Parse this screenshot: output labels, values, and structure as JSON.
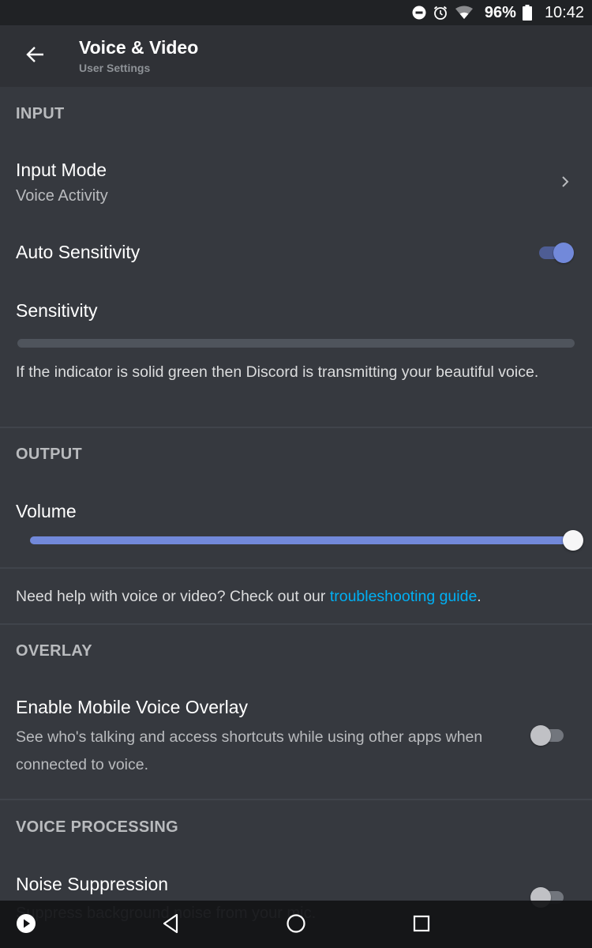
{
  "status_bar": {
    "icons": [
      "do-not-disturb-icon",
      "alarm-icon",
      "wifi-icon",
      "battery-icon"
    ],
    "battery_percent": "96%",
    "time": "10:42"
  },
  "header": {
    "back_icon": "arrow-left-icon",
    "title": "Voice & Video",
    "subtitle": "User Settings"
  },
  "sections": {
    "input": {
      "header": "INPUT",
      "input_mode": {
        "title": "Input Mode",
        "value": "Voice Activity"
      },
      "auto_sensitivity": {
        "title": "Auto Sensitivity",
        "enabled": true
      },
      "sensitivity": {
        "title": "Sensitivity"
      },
      "description": "If the indicator is solid green then Discord is transmitting your beautiful voice."
    },
    "output": {
      "header": "OUTPUT",
      "volume": {
        "title": "Volume",
        "value_percent": 100
      }
    },
    "help": {
      "text": "Need help with voice or video? Check out our ",
      "link": "troubleshooting guide",
      "suffix": "."
    },
    "overlay": {
      "header": "OVERLAY",
      "mobile_voice_overlay": {
        "title": "Enable Mobile Voice Overlay",
        "description": "See who's talking and access shortcuts while using other apps when connected to voice.",
        "enabled": false
      }
    },
    "voice_processing": {
      "header": "VOICE PROCESSING",
      "noise_suppression": {
        "title": "Noise Suppression",
        "description": "Suppress background noise from your mic.",
        "enabled": false
      }
    }
  },
  "nav_bar": {
    "buttons": [
      "play-icon",
      "back-triangle-icon",
      "home-circle-icon",
      "recents-square-icon"
    ]
  },
  "colors": {
    "accent": "#7289da",
    "link": "#00b0f4",
    "background": "#36393f",
    "header_background": "#2f3136"
  }
}
